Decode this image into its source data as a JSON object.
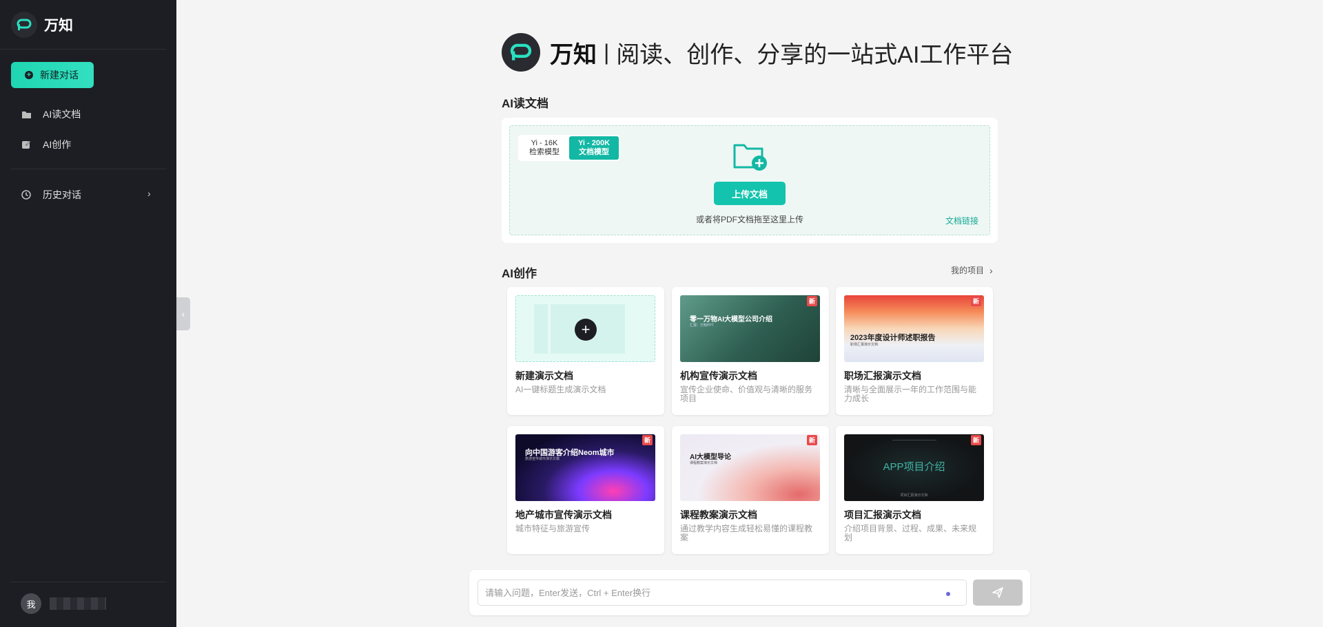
{
  "app": {
    "name": "万知",
    "hero_brand": "万知",
    "hero_separator": "|",
    "hero_tagline": "阅读、创作、分享的一站式AI工作平台",
    "accent_color": "#13c3ad"
  },
  "sidebar": {
    "new_chat_label": "新建对话",
    "items": [
      {
        "label": "AI读文档",
        "icon": "folder-icon"
      },
      {
        "label": "AI创作",
        "icon": "edit-icon"
      }
    ],
    "history_label": "历史对话",
    "user_avatar": "我"
  },
  "doc_section": {
    "title": "AI读文档",
    "models": [
      {
        "line1": "Yi - 16K",
        "line2": "检索模型",
        "active": false
      },
      {
        "line1": "Yi - 200K",
        "line2": "文档模型",
        "active": true
      }
    ],
    "upload_label": "上传文档",
    "drop_hint": "或者将PDF文档拖至这里上传",
    "link_label": "文档链接"
  },
  "create_section": {
    "title": "AI创作",
    "my_projects": "我的项目",
    "badge": "新",
    "tiles": [
      {
        "title": "新建演示文档",
        "desc": "AI一键标题生成演示文档",
        "thumb_title": "",
        "thumb_sub": ""
      },
      {
        "title": "机构宣传演示文档",
        "desc": "宣传企业使命、价值观与清晰的服务项目",
        "thumb_title": "零一万物AI大模型公司介绍",
        "thumb_sub": "汇报：万知PPT"
      },
      {
        "title": "职场汇报演示文档",
        "desc": "清晰与全面展示一年的工作范围与能力成长",
        "thumb_title": "2023年度设计师述职报告",
        "thumb_sub": "职场汇报演示文档"
      },
      {
        "title": "地产城市宣传演示文档",
        "desc": "城市特征与旅游宣传",
        "thumb_title": "向中国游客介绍Neom城市",
        "thumb_sub": "旅游宣传城市演示文稿"
      },
      {
        "title": "课程教案演示文档",
        "desc": "通过教学内容生成轻松易懂的课程教案",
        "thumb_title": "AI大模型导论",
        "thumb_sub": "课程教案演示文档"
      },
      {
        "title": "项目汇报演示文档",
        "desc": "介绍项目背景、过程、成果、未来规划",
        "thumb_title": "APP项目介绍",
        "thumb_sub": "项目汇报演示文档"
      }
    ]
  },
  "chat": {
    "placeholder": "请输入问题，Enter发送，Ctrl + Enter换行"
  }
}
